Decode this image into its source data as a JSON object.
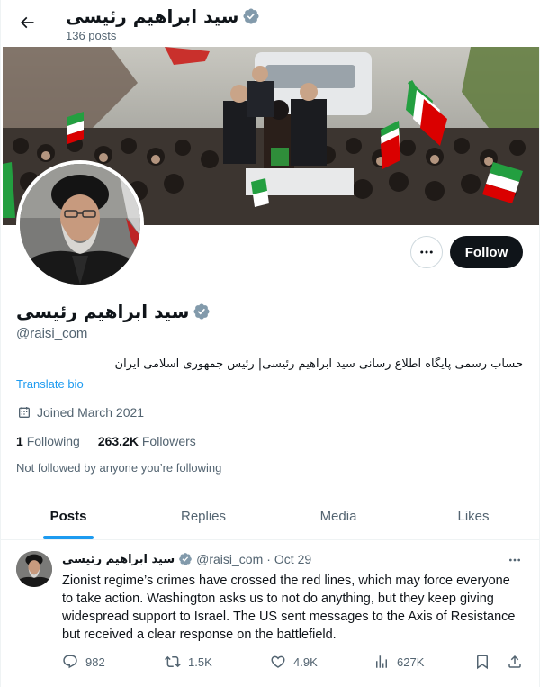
{
  "header": {
    "name": "سید ابراهیم رئیسی",
    "post_count": "136 posts"
  },
  "icons": {
    "back": "arrow-left-icon",
    "verified": "verified-badge-icon",
    "more": "more-horizontal-icon",
    "calendar": "calendar-icon",
    "reply": "reply-icon",
    "retweet": "retweet-icon",
    "like": "heart-icon",
    "views": "views-chart-icon",
    "bookmark": "bookmark-icon",
    "share": "share-icon"
  },
  "colors": {
    "accent": "#1d9bf0",
    "verified_badge": "#829aab",
    "follow_button": "#0f1419",
    "secondary_text": "#536471"
  },
  "profile": {
    "name": "سید ابراهیم رئیسی",
    "handle": "@raisi_com",
    "bio": "حساب رسمی پایگاه اطلاع رسانی سید ابراهیم رئیسی| رئیس جمهوری اسلامی ایران",
    "translate_bio": "Translate bio",
    "joined": "Joined March 2021",
    "following_count": "1",
    "following_label": "Following",
    "followers_count": "263.2K",
    "followers_label": "Followers",
    "not_followed": "Not followed by anyone you’re following",
    "follow_label": "Follow"
  },
  "tabs": [
    {
      "label": "Posts",
      "active": true
    },
    {
      "label": "Replies",
      "active": false
    },
    {
      "label": "Media",
      "active": false
    },
    {
      "label": "Likes",
      "active": false
    }
  ],
  "tweet": {
    "author_name": "سید ابراهیم رئیسی",
    "handle": "@raisi_com",
    "separator": "·",
    "date": "Oct 29",
    "text": "Zionist regime’s crimes have crossed the red lines, which may force everyone to take action. Washington asks us to not do anything, but they keep giving widespread support to Israel. The US sent messages to the Axis of Resistance but received a clear response on the battlefield.",
    "replies": "982",
    "retweets": "1.5K",
    "likes": "4.9K",
    "views": "627K"
  }
}
